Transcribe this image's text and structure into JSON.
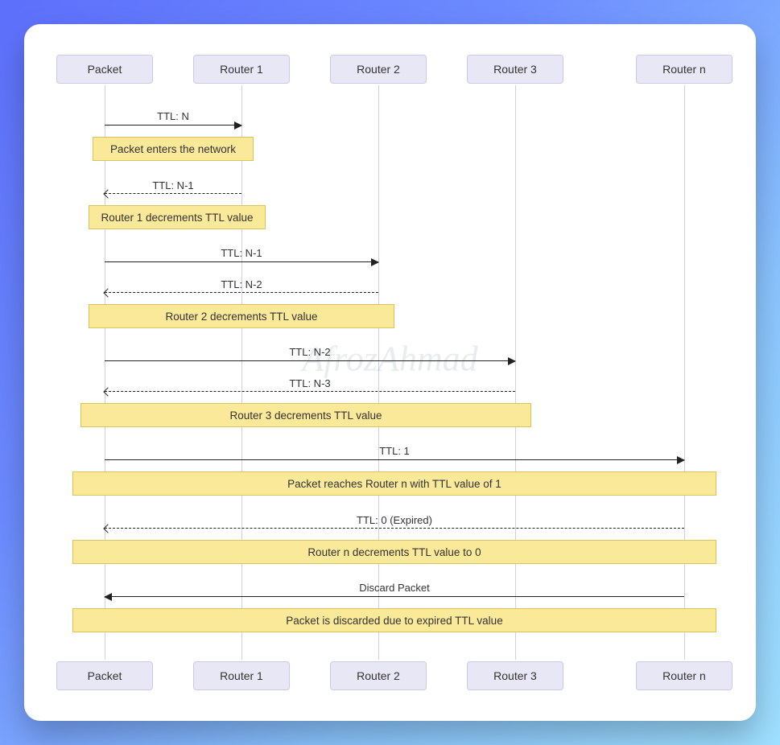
{
  "actors": {
    "packet": "Packet",
    "router1": "Router 1",
    "router2": "Router 2",
    "router3": "Router 3",
    "routern": "Router n"
  },
  "messages": {
    "m1": "TTL: N",
    "m2": "TTL: N-1",
    "m3": "TTL: N-1",
    "m4": "TTL: N-2",
    "m5": "TTL: N-2",
    "m6": "TTL: N-3",
    "m7": "TTL: 1",
    "m8": "TTL: 0 (Expired)",
    "m9": "Discard Packet"
  },
  "notes": {
    "n1": "Packet enters the network",
    "n2": "Router 1 decrements TTL value",
    "n3": "Router 2 decrements TTL value",
    "n4": "Router 3 decrements TTL value",
    "n5": "Packet reaches Router n with TTL value of 1",
    "n6": "Router n decrements TTL value to 0",
    "n7": "Packet is discarded due to expired TTL value"
  },
  "watermark": "AfrozAhmad"
}
